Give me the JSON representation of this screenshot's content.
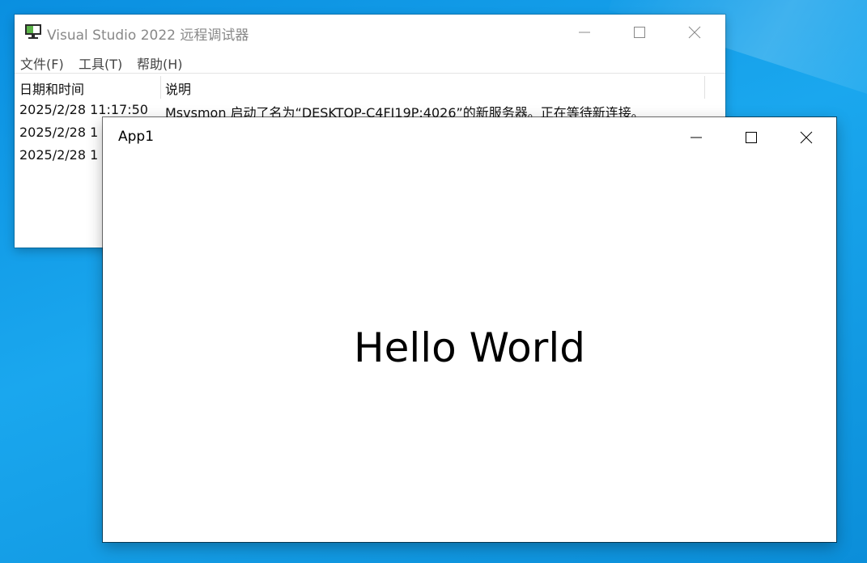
{
  "debugger_window": {
    "title": "Visual Studio 2022 远程调试器",
    "icon": "monitor-icon",
    "menu": [
      "文件(F)",
      "工具(T)",
      "帮助(H)"
    ],
    "columns": [
      "日期和时间",
      "说明"
    ],
    "rows": [
      {
        "datetime": "2025/2/28 11:17:50",
        "description": "Msvsmon 启动了名为“DESKTOP-C4FJ19P:4026”的新服务器。正在等待新连接。"
      },
      {
        "datetime": "2025/2/28 1",
        "description": ""
      },
      {
        "datetime": "2025/2/28 1",
        "description": ""
      }
    ]
  },
  "app_window": {
    "title": "App1",
    "content_text": "Hello World"
  },
  "colors": {
    "desktop_blue": "#0a8fe0",
    "window_bg": "#ffffff",
    "inactive_title": "#888888"
  }
}
